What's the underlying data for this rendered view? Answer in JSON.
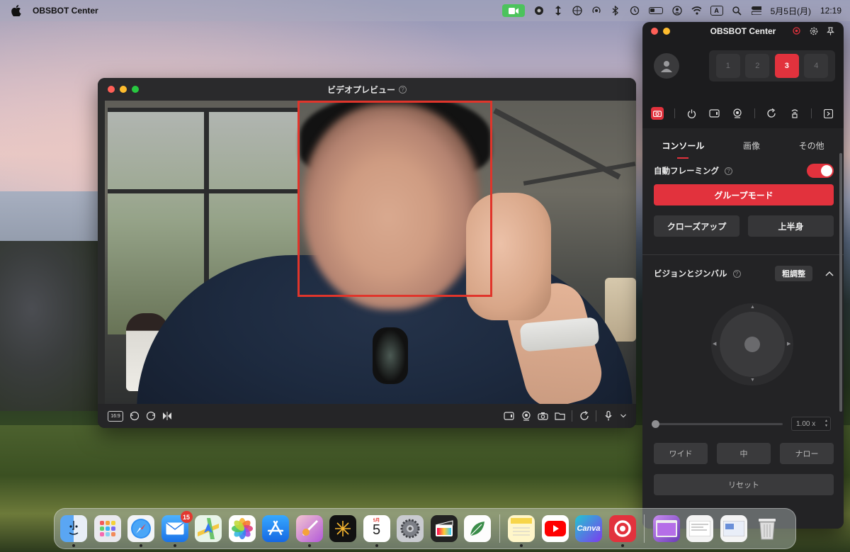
{
  "menubar": {
    "app_name": "OBSBOT Center",
    "date_label": "5月5日(月)",
    "time": "12:19",
    "input_source": "A"
  },
  "preview_window": {
    "title": "ビデオプレビュー",
    "aspect_label": "16:9"
  },
  "panel": {
    "title": "OBSBOT Center",
    "preset_slots": [
      "1",
      "2",
      "3",
      "4"
    ],
    "active_slot": "3",
    "tabs": [
      "コンソール",
      "画像",
      "その他"
    ],
    "active_tab": "コンソール",
    "auto_framing_label": "自動フレーミング",
    "auto_framing_on": true,
    "group_mode_label": "グループモード",
    "closeup_label": "クローズアップ",
    "upper_body_label": "上半身",
    "vision_gimbal_label": "ビジョンとジンバル",
    "coarse_label": "粗調整",
    "zoom_value": "1.00 x",
    "zoom_level": 0,
    "wide_label": "ワイド",
    "mid_label": "中",
    "narrow_label": "ナロー",
    "reset_label": "リセット"
  },
  "dock": {
    "mail_badge": "15",
    "calendar_month": "5月",
    "calendar_day": "5",
    "canva_label": "Canva"
  },
  "colors": {
    "accent": "#e2323d",
    "face_box": "#e0352b",
    "menubar_camera": "#4cc35c"
  }
}
